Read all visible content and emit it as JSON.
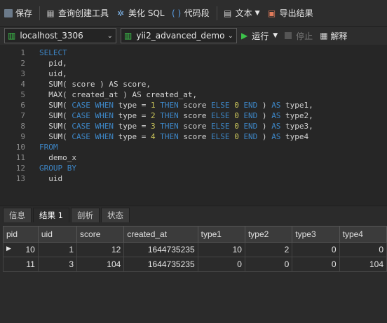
{
  "toolbar": {
    "save": "保存",
    "query_builder": "查询创建工具",
    "beautify": "美化 SQL",
    "snippet": "代码段",
    "text": "文本",
    "export": "导出结果"
  },
  "connection": {
    "server": "localhost_3306",
    "database": "yii2_advanced_demo",
    "run": "运行",
    "stop": "停止",
    "explain": "解释"
  },
  "editor": {
    "lines": [
      {
        "n": "1",
        "html": "<span class=\"kw\">SELECT</span>"
      },
      {
        "n": "2",
        "html": "  pid,"
      },
      {
        "n": "3",
        "html": "  uid,"
      },
      {
        "n": "4",
        "html": "  SUM( score ) AS score,"
      },
      {
        "n": "5",
        "html": "  MAX( created_at ) AS created_at,"
      },
      {
        "n": "6",
        "html": "  SUM( <span class=\"kw\">CASE WHEN</span> type = <span class=\"num\">1</span> <span class=\"kw\">THEN</span> score <span class=\"kw\">ELSE</span> <span class=\"num\">0</span> <span class=\"kw\">END</span> ) <span class=\"kw\">AS</span> type1,"
      },
      {
        "n": "7",
        "html": "  SUM( <span class=\"kw\">CASE WHEN</span> type = <span class=\"num\">2</span> <span class=\"kw\">THEN</span> score <span class=\"kw\">ELSE</span> <span class=\"num\">0</span> <span class=\"kw\">END</span> ) <span class=\"kw\">AS</span> type2,"
      },
      {
        "n": "8",
        "html": "  SUM( <span class=\"kw\">CASE WHEN</span> type = <span class=\"num\">3</span> <span class=\"kw\">THEN</span> score <span class=\"kw\">ELSE</span> <span class=\"num\">0</span> <span class=\"kw\">END</span> ) <span class=\"kw\">AS</span> type3,"
      },
      {
        "n": "9",
        "html": "  SUM( <span class=\"kw\">CASE WHEN</span> type = <span class=\"num\">4</span> <span class=\"kw\">THEN</span> score <span class=\"kw\">ELSE</span> <span class=\"num\">0</span> <span class=\"kw\">END</span> ) <span class=\"kw\">AS</span> type4"
      },
      {
        "n": "10",
        "html": "<span class=\"kw\">FROM</span>"
      },
      {
        "n": "11",
        "html": "  demo_x"
      },
      {
        "n": "12",
        "html": "<span class=\"kw\">GROUP BY</span>"
      },
      {
        "n": "13",
        "html": "  uid"
      }
    ]
  },
  "tabs": [
    "信息",
    "结果 1",
    "剖析",
    "状态"
  ],
  "active_tab": 1,
  "results": {
    "columns": [
      "pid",
      "uid",
      "score",
      "created_at",
      "type1",
      "type2",
      "type3",
      "type4"
    ],
    "rows": [
      [
        "10",
        "1",
        "12",
        "1644735235",
        "10",
        "2",
        "0",
        "0"
      ],
      [
        "11",
        "3",
        "104",
        "1644735235",
        "0",
        "0",
        "0",
        "104"
      ]
    ]
  },
  "colors": {
    "keyword": "#3d86c6",
    "number": "#c9c45a",
    "run_icon": "#3cc24a"
  }
}
